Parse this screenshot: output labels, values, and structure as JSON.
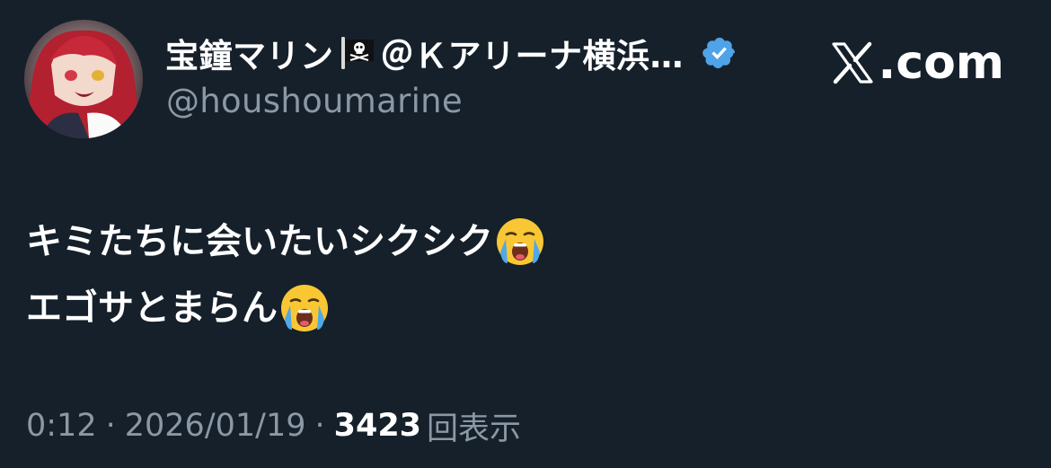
{
  "author": {
    "display_name": "宝鐘マリン",
    "display_name_suffix": "＠Ｋアリーナ横浜…",
    "flag_icon": "pirate-flag-icon",
    "verified_icon": "verified-badge-icon",
    "verified_color": "#4fa3e8",
    "handle": "@houshoumarine",
    "avatar": "avatar-image"
  },
  "brand": {
    "icon": "x-logo-icon",
    "text": ".com"
  },
  "tweet": {
    "lines": [
      {
        "text": "キミたちに会いたいシクシク",
        "emoji": "loudly-crying-face-icon"
      },
      {
        "text": "エゴサとまらん",
        "emoji": "loudly-crying-face-icon"
      }
    ]
  },
  "meta": {
    "time": "0:12",
    "separator": "·",
    "date": "2026/01/19",
    "views_count": "3423",
    "views_label": "回表示"
  },
  "colors": {
    "background": "#15202b",
    "primary_text": "#ffffff",
    "secondary_text": "#8b98a5"
  }
}
